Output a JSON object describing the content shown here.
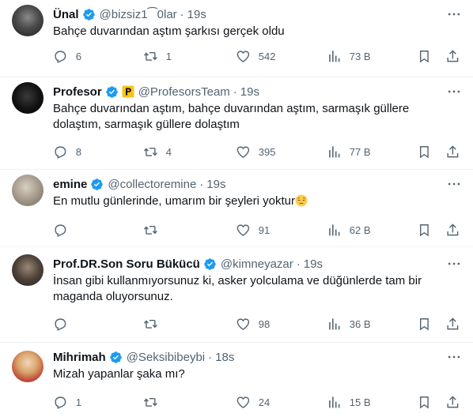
{
  "tweets": [
    {
      "name": "Ünal",
      "handle": "@bizsiz1⁀0lar",
      "time": "19s",
      "text": "Bahçe duvarından aştım şarkısı gerçek oldu",
      "replies": "6",
      "retweets": "1",
      "likes": "542",
      "views": "73 B"
    },
    {
      "name": "Profesor",
      "handle": "@ProfesorsTeam",
      "time": "19s",
      "text": "Bahçe duvarından aştım, bahçe duvarından aştım, sarmaşık güllere dolaştım, sarmaşık güllere dolaştım",
      "replies": "8",
      "retweets": "4",
      "likes": "395",
      "views": "77 B"
    },
    {
      "name": "emine",
      "handle": "@collectoremine",
      "time": "19s",
      "text": "En mutlu günlerinde, umarım bir şeyleri yoktur",
      "emoji": "pensive-face",
      "replies": "",
      "retweets": "",
      "likes": "91",
      "views": "62 B"
    },
    {
      "name": "Prof.DR.Son Soru Bükücü",
      "handle": "@kimneyazar",
      "time": "19s",
      "text": "İnsan gibi kullanmıyorsunuz ki, asker yolculama ve düğünlerde tam bir maganda oluyorsunuz.",
      "replies": "",
      "retweets": "",
      "likes": "98",
      "views": "36 B"
    },
    {
      "name": "Mihrimah",
      "handle": "@Seksibibeybi",
      "time": "18s",
      "text": "Mizah yapanlar şaka mı?",
      "replies": "1",
      "retweets": "",
      "likes": "24",
      "views": "15 B"
    }
  ],
  "colors": {
    "verified": "#1d9bf0",
    "secondary_text": "#536471",
    "affiliate_badge": "#f7c41a"
  }
}
